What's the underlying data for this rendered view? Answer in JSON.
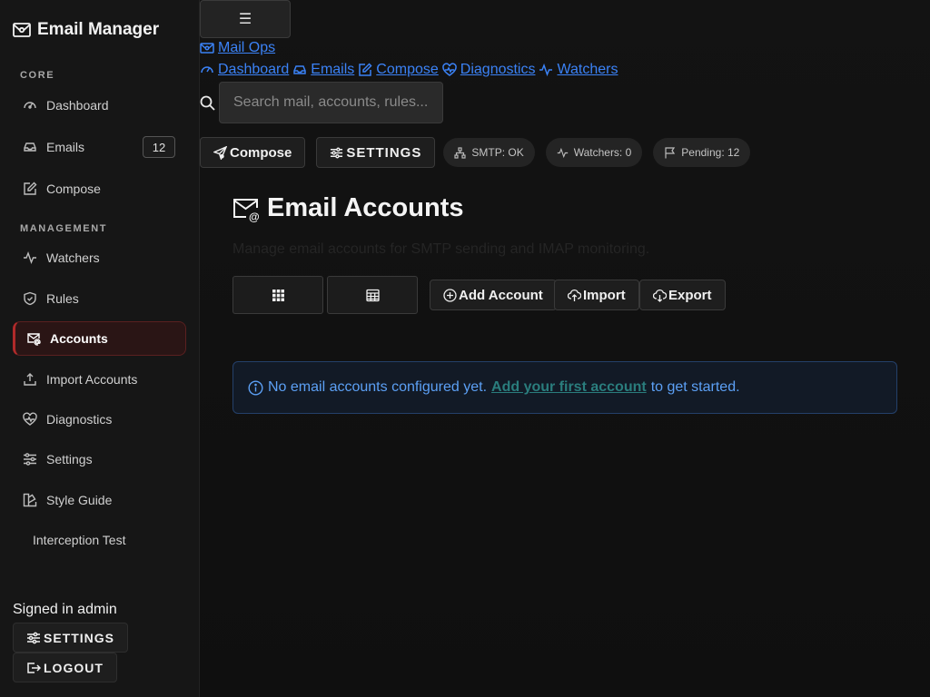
{
  "app": {
    "title": "Email Manager",
    "icon": "envelope-card-icon"
  },
  "sidebar": {
    "sections": {
      "core": "CORE",
      "management": "MANAGEMENT"
    },
    "items": [
      {
        "label": "Dashboard",
        "icon": "gauge-icon"
      },
      {
        "label": "Emails",
        "icon": "inbox-icon",
        "badge": "12"
      },
      {
        "label": "Compose",
        "icon": "edit-icon"
      },
      {
        "label": "Watchers",
        "icon": "activity-icon"
      },
      {
        "label": "Rules",
        "icon": "shield-check-icon"
      },
      {
        "label": "Accounts",
        "icon": "envelope-at-icon",
        "active": true
      },
      {
        "label": "Import Accounts",
        "icon": "upload-icon"
      },
      {
        "label": "Diagnostics",
        "icon": "heart-pulse-icon"
      },
      {
        "label": "Settings",
        "icon": "sliders-icon"
      },
      {
        "label": "Style Guide",
        "icon": "palette-icon"
      },
      {
        "label": "Interception Test"
      }
    ],
    "signed_in": "Signed in admin",
    "settings_label": "SETTINGS",
    "logout_label": "LOGOUT"
  },
  "topbar": {
    "menu_glyph": "☰",
    "brand_link": "Mail Ops",
    "links": [
      "Dashboard",
      "Emails",
      "Compose",
      "Diagnostics",
      "Watchers"
    ],
    "search_placeholder": "Search mail, accounts, rules...",
    "compose_label": "Compose",
    "settings_label": "SETTINGS",
    "status": {
      "smtp": "SMTP: OK",
      "watchers": "Watchers: 0",
      "pending": "Pending: 12"
    }
  },
  "page": {
    "title": "Email Accounts",
    "subtitle": "Manage email accounts for SMTP sending and IMAP monitoring.",
    "actions": {
      "add": "Add Account",
      "import": "Import",
      "export": "Export"
    },
    "alert": {
      "before": "No email accounts configured yet.",
      "link": "Add your first account",
      "after": "to get started."
    }
  },
  "colors": {
    "accent_red": "#b02a2a",
    "link_blue": "#3b82f6",
    "alert_text": "#5ca0f5",
    "alert_link": "#2a7d7d"
  }
}
